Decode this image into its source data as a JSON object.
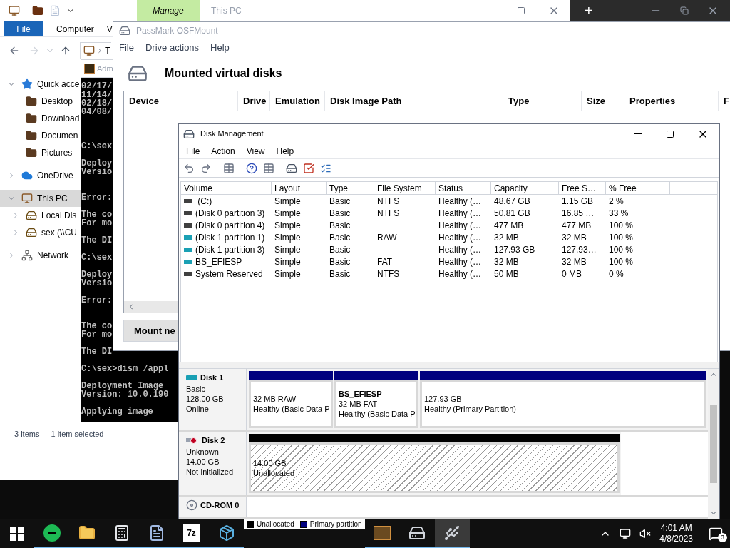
{
  "background_window": {
    "new_tab": "+"
  },
  "explorer": {
    "title": "This PC",
    "context_tab": "Manage",
    "ribbon_tabs": [
      {
        "label": "File",
        "selected": true
      },
      {
        "label": "Computer",
        "selected": false
      },
      {
        "label": "V",
        "selected": false
      }
    ],
    "address": "T",
    "nav": [
      {
        "label": "Quick acce",
        "expanded": true,
        "selected": false,
        "children": [
          {
            "label": "Desktop"
          },
          {
            "label": "Download"
          },
          {
            "label": "Documen"
          },
          {
            "label": "Pictures"
          }
        ]
      },
      {
        "label": "OneDrive",
        "expanded": false,
        "selected": false
      },
      {
        "label": "This PC",
        "expanded": true,
        "selected": true,
        "children": [
          {
            "label": "Local Dis",
            "expanded": false
          },
          {
            "label": "sex (\\\\CU",
            "expanded": false
          }
        ]
      },
      {
        "label": "Network",
        "expanded": false,
        "selected": false
      }
    ],
    "status_bar": [
      "3 items",
      "1 item selected"
    ]
  },
  "console": {
    "title": "Adm",
    "blocks": [
      [
        "02/17/",
        "11/14/",
        "02/18/",
        "04/08/"
      ],
      [
        "C:\\sex"
      ],
      [
        "Deploy",
        "Versio"
      ],
      [
        "Error:"
      ],
      [
        "The co",
        "For mo"
      ],
      [
        "The DI"
      ],
      [
        "C:\\sex"
      ],
      [
        "Deploy",
        "Versio"
      ],
      [
        "Error:"
      ],
      [
        "The co",
        "For mo"
      ],
      [
        "The DI"
      ],
      [
        "C:\\sex>dism /appl"
      ],
      [
        "Deployment Image",
        "Version: 10.0.190"
      ],
      [
        "Applying image"
      ]
    ]
  },
  "osfmount": {
    "title": "PassMark OSFMount",
    "menu": [
      "File",
      "Drive actions",
      "Help"
    ],
    "heading": "Mounted virtual disks",
    "columns": [
      "Device",
      "Drive",
      "Emulation",
      "Disk Image Path",
      "Type",
      "Size",
      "Properties",
      "F"
    ],
    "button": "Mount ne"
  },
  "disk_management": {
    "title": "Disk Management",
    "menu": [
      "File",
      "Action",
      "View",
      "Help"
    ],
    "columns": [
      "Volume",
      "Layout",
      "Type",
      "File System",
      "Status",
      "Capacity",
      "Free S…",
      "% Free"
    ],
    "volumes": [
      {
        "color": "#404040",
        "volume": " (C:)",
        "layout": "Simple",
        "type": "Basic",
        "file_system": "NTFS",
        "status": "Healthy (…",
        "capacity": "48.67 GB",
        "free": "1.15 GB",
        "percent_free": "2 %"
      },
      {
        "color": "#404040",
        "volume": "(Disk 0 partition 3)",
        "layout": "Simple",
        "type": "Basic",
        "file_system": "NTFS",
        "status": "Healthy (…",
        "capacity": "50.81 GB",
        "free": "16.85 …",
        "percent_free": "33 %"
      },
      {
        "color": "#404040",
        "volume": "(Disk 0 partition 4)",
        "layout": "Simple",
        "type": "Basic",
        "status": "Healthy (…",
        "capacity": "477 MB",
        "free": "477 MB",
        "percent_free": "100 %"
      },
      {
        "color": "#1aa0b4",
        "volume": "(Disk 1 partition 1)",
        "layout": "Simple",
        "type": "Basic",
        "file_system": "RAW",
        "status": "Healthy (…",
        "capacity": "32 MB",
        "free": "32 MB",
        "percent_free": "100 %"
      },
      {
        "color": "#1aa0b4",
        "volume": "(Disk 1 partition 3)",
        "layout": "Simple",
        "type": "Basic",
        "status": "Healthy (…",
        "capacity": "127.93 GB",
        "free": "127.93…",
        "percent_free": "100 %"
      },
      {
        "color": "#1aa0b4",
        "volume": "BS_EFIESP",
        "layout": "Simple",
        "type": "Basic",
        "file_system": "FAT",
        "status": "Healthy (…",
        "capacity": "32 MB",
        "free": "32 MB",
        "percent_free": "100 %"
      },
      {
        "color": "#404040",
        "volume": "System Reserved",
        "layout": "Simple",
        "type": "Basic",
        "file_system": "NTFS",
        "status": "Healthy (…",
        "capacity": "50 MB",
        "free": "0 MB",
        "percent_free": "0 %"
      }
    ],
    "disks": [
      {
        "kind": "disk",
        "name": "Disk 1",
        "info": [
          "Basic",
          "128.00 GB",
          "Online"
        ],
        "partitions": [
          {
            "kind": "primary",
            "lines": [
              "32 MB RAW",
              "Healthy (Basic Data P"
            ]
          },
          {
            "kind": "primary",
            "name": "BS_EFIESP",
            "lines": [
              "32 MB FAT",
              "Healthy (Basic Data P"
            ]
          },
          {
            "kind": "primary",
            "lines": [
              "127.93 GB",
              "Healthy (Primary Partition)"
            ]
          }
        ]
      },
      {
        "kind": "disk-error",
        "name": "Disk 2",
        "info": [
          "Unknown",
          "14.00 GB",
          "Not Initialized"
        ],
        "partitions": [
          {
            "kind": "unallocated",
            "lines": [
              "14.00 GB",
              "Unallocated"
            ]
          }
        ]
      },
      {
        "kind": "cdrom",
        "name": "CD-ROM 0"
      }
    ],
    "legend": [
      {
        "kind": "unallocated",
        "label": "Unallocated"
      },
      {
        "kind": "primary",
        "label": "Primary partition"
      }
    ]
  },
  "taskbar": {
    "apps": [
      {
        "kind": "green-app",
        "running": true,
        "active": false
      },
      {
        "kind": "folder",
        "running": true,
        "active": false
      },
      {
        "kind": "calculator",
        "running": true,
        "active": false
      },
      {
        "kind": "document",
        "running": true,
        "active": false
      },
      {
        "kind": "text-logo",
        "label": "7z",
        "running": true,
        "active": false
      },
      {
        "kind": "installer",
        "running": true,
        "active": false
      },
      {
        "kind": "sticker",
        "running": true,
        "active": false
      },
      {
        "kind": "disk",
        "running": true,
        "active": false
      },
      {
        "kind": "usb-disk",
        "running": true,
        "active": true
      }
    ],
    "time": "4:01 AM",
    "date": "4/8/2023",
    "notifications": "3"
  }
}
